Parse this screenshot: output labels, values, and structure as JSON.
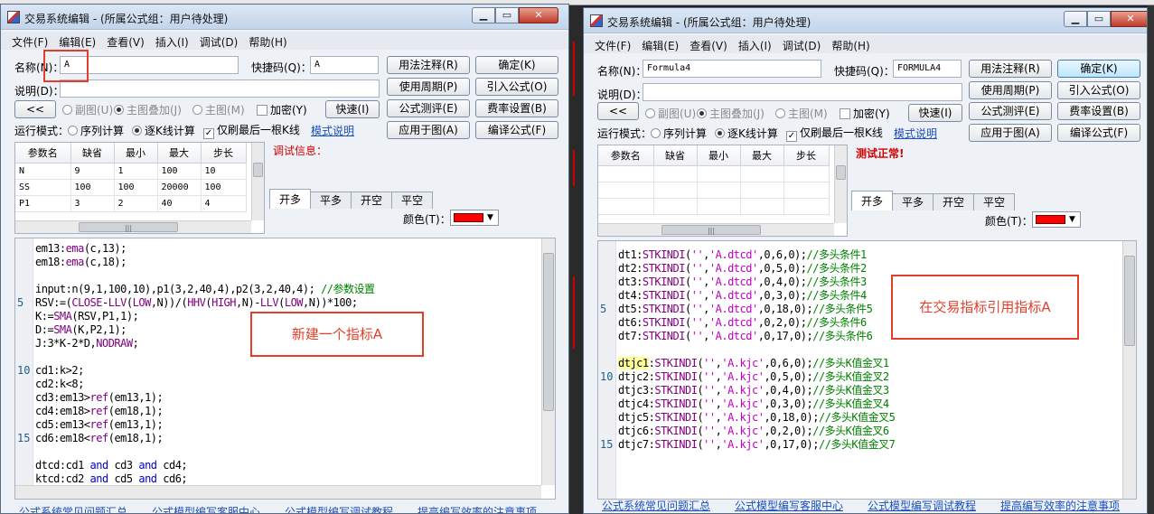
{
  "background": {
    "colors": {
      "desktop": "#1b2230",
      "accent_red": "#cc0000"
    }
  },
  "left": {
    "title": "交易系统编辑 - (所属公式组：用户待处理)",
    "menu": [
      "文件(F)",
      "编辑(E)",
      "查看(V)",
      "插入(I)",
      "调试(D)",
      "帮助(H)"
    ],
    "name_label": "名称(N)：",
    "name_value": "A",
    "shortcut_label": "快捷码(Q)：",
    "shortcut_value": "A",
    "desc_label": "说明(D)：",
    "btn_usage": "用法注释(R)",
    "btn_ok": "确定(K)",
    "btn_period": "使用周期(P)",
    "btn_import": "引入公式(O)",
    "btn_test": "公式测评(E)",
    "btn_fee": "费率设置(B)",
    "btn_apply": "应用于图(A)",
    "btn_compile": "编译公式(F)",
    "btn_collapse": "<<",
    "radio_sub": "副图(U)",
    "radio_main_overlay": "主图叠加(J)",
    "radio_main": "主图(M)",
    "chk_encrypt": "加密(Y)",
    "btn_quick": "快速(I)",
    "run_mode_label": "运行模式：",
    "run_seq": "序列计算",
    "run_bar": "逐K线计算",
    "chk_last": "仅刷最后一根K线",
    "mode_link": "模式说明",
    "debug_info": "调试信息：",
    "param_headers": [
      "参数名",
      "缺省",
      "最小",
      "最大",
      "步长"
    ],
    "params": [
      [
        "N",
        "9",
        "1",
        "100",
        "10"
      ],
      [
        "SS",
        "100",
        "100",
        "20000",
        "100"
      ],
      [
        "P1",
        "3",
        "2",
        "40",
        "4"
      ]
    ],
    "tabs": [
      "开多",
      "平多",
      "开空",
      "平空"
    ],
    "color_label": "颜色(T)：",
    "code_lines": [
      {
        "n": "",
        "t": "em13:ema(c,13);"
      },
      {
        "n": "",
        "t": "em18:ema(c,18);"
      },
      {
        "n": "",
        "t": ""
      },
      {
        "n": "",
        "t": "input:n(9,1,100,10),p1(3,2,40,4),p2(3,2,40,4); //参数设置"
      },
      {
        "n": "5",
        "t": "RSV:=(CLOSE-LLV(LOW,N))/(HHV(HIGH,N)-LLV(LOW,N))*100;"
      },
      {
        "n": "",
        "t": "K:=SMA(RSV,P1,1);"
      },
      {
        "n": "",
        "t": "D:=SMA(K,P2,1);"
      },
      {
        "n": "",
        "t": "J:3*K-2*D,NODRAW;"
      },
      {
        "n": "",
        "t": ""
      },
      {
        "n": "10",
        "t": "cd1:k>2;"
      },
      {
        "n": "",
        "t": "cd2:k<8;"
      },
      {
        "n": "",
        "t": "cd3:em13>ref(em13,1);"
      },
      {
        "n": "",
        "t": "cd4:em18>ref(em18,1);"
      },
      {
        "n": "",
        "t": "cd5:em13<ref(em13,1);"
      },
      {
        "n": "15",
        "t": "cd6:em18<ref(em18,1);"
      },
      {
        "n": "",
        "t": ""
      },
      {
        "n": "",
        "t": "dtcd:cd1 and cd3 and cd4;"
      },
      {
        "n": "",
        "t": "ktcd:cd2 and cd5 and cd6;"
      }
    ],
    "annotation": "新建一个指标A",
    "footer_links": [
      "公式系统常见问题汇总",
      "公式模型编写客服中心",
      "公式模型编写调试教程",
      "提高编写效率的注意事项"
    ]
  },
  "right": {
    "title": "交易系统编辑 - (所属公式组：用户待处理)",
    "menu": [
      "文件(F)",
      "编辑(E)",
      "查看(V)",
      "插入(I)",
      "调试(D)",
      "帮助(H)"
    ],
    "name_label": "名称(N)：",
    "name_value": "Formula4",
    "shortcut_label": "快捷码(Q)：",
    "shortcut_value": "FORMULA4",
    "desc_label": "说明(D)：",
    "btn_usage": "用法注释(R)",
    "btn_ok": "确定(K)",
    "btn_period": "使用周期(P)",
    "btn_import": "引入公式(O)",
    "btn_test": "公式测评(E)",
    "btn_fee": "费率设置(B)",
    "btn_apply": "应用于图(A)",
    "btn_compile": "编译公式(F)",
    "btn_collapse": "<<",
    "radio_sub": "副图(U)",
    "radio_main_overlay": "主图叠加(J)",
    "radio_main": "主图(M)",
    "chk_encrypt": "加密(Y)",
    "btn_quick": "快速(I)",
    "run_mode_label": "运行模式：",
    "run_seq": "序列计算",
    "run_bar": "逐K线计算",
    "chk_last": "仅刷最后一根K线",
    "mode_link": "模式说明",
    "debug_info": "测试正常!",
    "param_headers": [
      "参数名",
      "缺省",
      "最小",
      "最大",
      "步长"
    ],
    "tabs": [
      "开多",
      "平多",
      "开空",
      "平空"
    ],
    "color_label": "颜色(T)：",
    "code_lines": [
      {
        "n": "",
        "t": "dt1:STKINDI('','A.dtcd',0,6,0);//多头条件1"
      },
      {
        "n": "",
        "t": "dt2:STKINDI('','A.dtcd',0,5,0);//多头条件2"
      },
      {
        "n": "",
        "t": "dt3:STKINDI('','A.dtcd',0,4,0);//多头条件3"
      },
      {
        "n": "",
        "t": "dt4:STKINDI('','A.dtcd',0,3,0);//多头条件4"
      },
      {
        "n": "5",
        "t": "dt5:STKINDI('','A.dtcd',0,18,0);//多头条件5"
      },
      {
        "n": "",
        "t": "dt6:STKINDI('','A.dtcd',0,2,0);//多头条件6"
      },
      {
        "n": "",
        "t": "dt7:STKINDI('','A.dtcd',0,17,0);//多头条件6"
      },
      {
        "n": "",
        "t": ""
      },
      {
        "n": "",
        "t": "dtjc1:STKINDI('','A.kjc',0,6,0);//多头K值金叉1"
      },
      {
        "n": "10",
        "t": "dtjc2:STKINDI('','A.kjc',0,5,0);//多头K值金叉2"
      },
      {
        "n": "",
        "t": "dtjc3:STKINDI('','A.kjc',0,4,0);//多头K值金叉3"
      },
      {
        "n": "",
        "t": "dtjc4:STKINDI('','A.kjc',0,3,0);//多头K值金叉4"
      },
      {
        "n": "",
        "t": "dtjc5:STKINDI('','A.kjc',0,18,0);//多头K值金叉5"
      },
      {
        "n": "",
        "t": "dtjc6:STKINDI('','A.kjc',0,2,0);//多头K值金叉6"
      },
      {
        "n": "15",
        "t": "dtjc7:STKINDI('','A.kjc',0,17,0);//多头K值金叉7"
      }
    ],
    "annotation": "在交易指标引用指标A",
    "footer_links": [
      "公式系统常见问题汇总",
      "公式模型编写客服中心",
      "公式模型编写调试教程",
      "提高编写效率的注意事项"
    ]
  }
}
